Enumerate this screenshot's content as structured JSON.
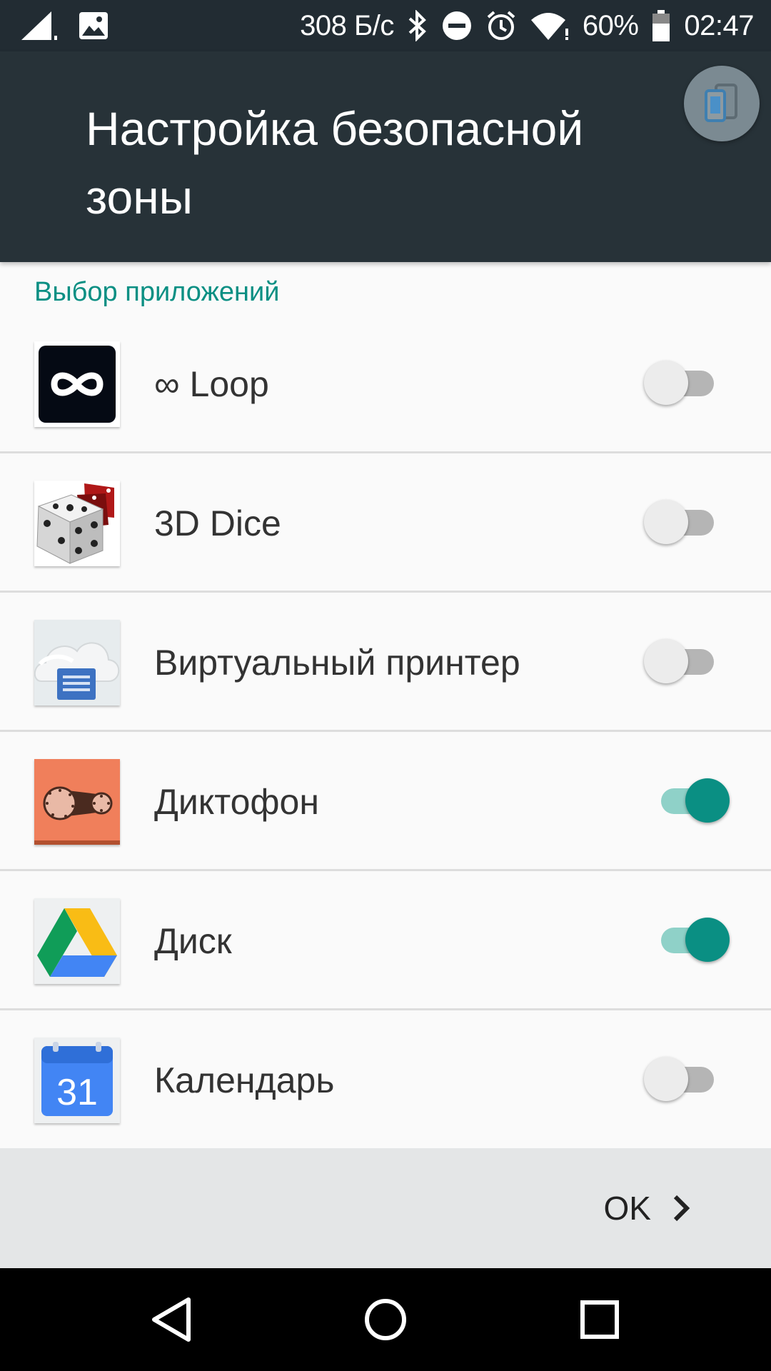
{
  "status_bar": {
    "speed": "308 Б/с",
    "battery": "60%",
    "time": "02:47",
    "icons": [
      "signal-icon",
      "image-icon",
      "bluetooth-icon",
      "dnd-icon",
      "alarm-icon",
      "wifi-icon",
      "battery-icon"
    ]
  },
  "header": {
    "title": "Настройка безопасной зоны"
  },
  "section": {
    "title": "Выбор приложений"
  },
  "apps": [
    {
      "label": "∞ Loop",
      "enabled": false
    },
    {
      "label": "3D Dice",
      "enabled": false
    },
    {
      "label": "Виртуальный принтер",
      "enabled": false
    },
    {
      "label": "Диктофон",
      "enabled": true
    },
    {
      "label": "Диск",
      "enabled": true
    },
    {
      "label": "Календарь",
      "enabled": false
    }
  ],
  "calendar_icon": {
    "day": "31"
  },
  "footer": {
    "ok_label": "OK"
  },
  "colors": {
    "accent": "#0a8f83",
    "header_bg": "#273238",
    "statusbar_bg": "#222c33"
  }
}
